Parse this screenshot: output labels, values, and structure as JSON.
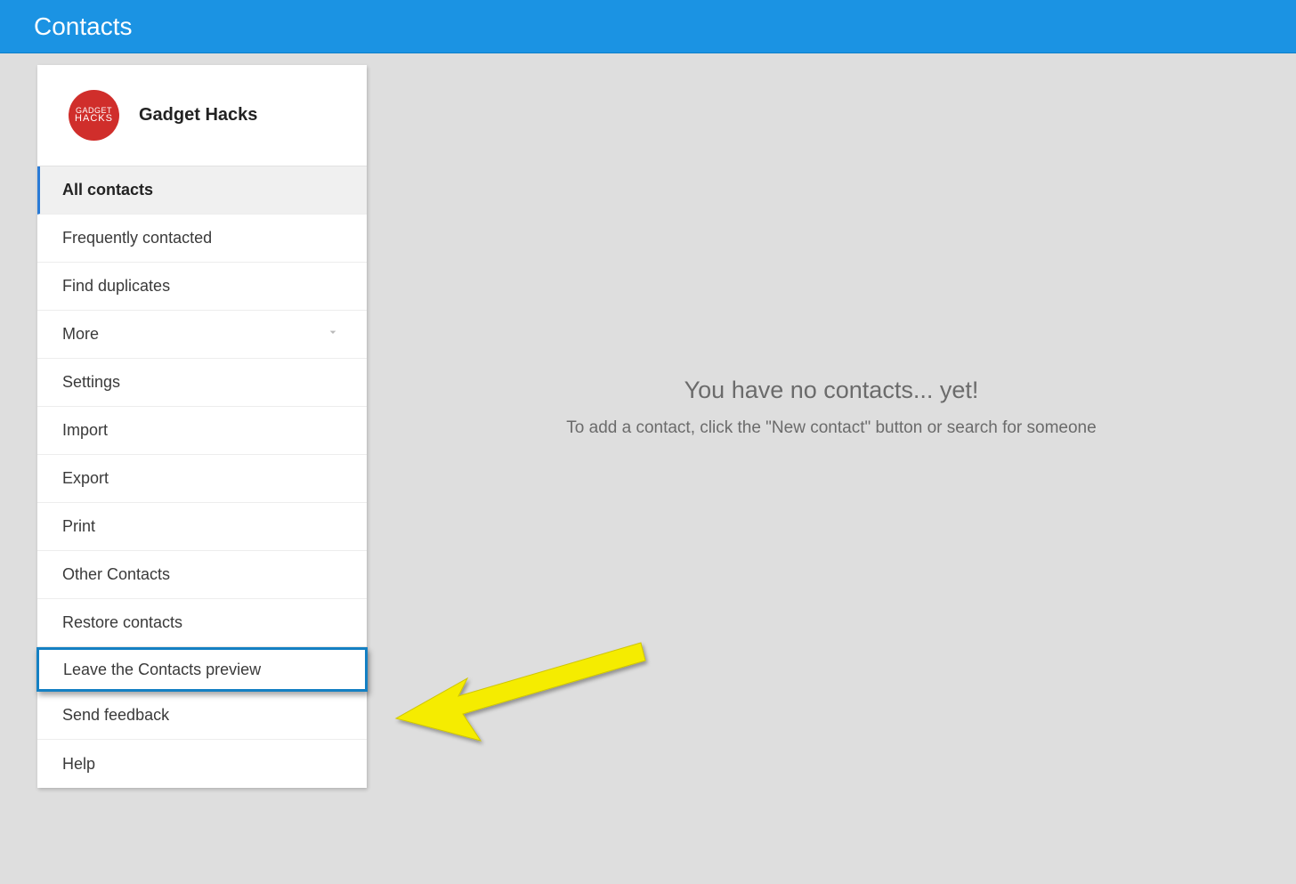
{
  "header": {
    "title": "Contacts"
  },
  "profile": {
    "name": "Gadget Hacks",
    "avatar_top": "GADGET",
    "avatar_bottom": "HACKS"
  },
  "sidebar": {
    "items": [
      {
        "label": "All contacts",
        "active": true
      },
      {
        "label": "Frequently contacted"
      },
      {
        "label": "Find duplicates"
      },
      {
        "label": "More",
        "expandable": true
      },
      {
        "label": "Settings"
      },
      {
        "label": "Import"
      },
      {
        "label": "Export"
      },
      {
        "label": "Print"
      },
      {
        "label": "Other Contacts"
      },
      {
        "label": "Restore contacts"
      },
      {
        "label": "Leave the Contacts preview",
        "highlighted": true
      },
      {
        "label": "Send feedback"
      },
      {
        "label": "Help"
      }
    ]
  },
  "main": {
    "empty_title": "You have no contacts... yet!",
    "empty_subtitle": "To add a contact, click the \"New contact\" button or search for someone"
  },
  "annotation": {
    "arrow_color": "#f5ec00"
  }
}
